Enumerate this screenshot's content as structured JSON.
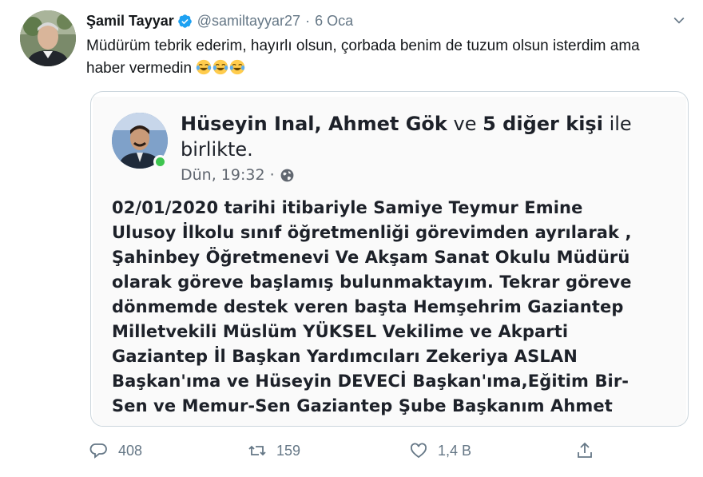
{
  "tweet": {
    "author_name": "Şamil Tayyar",
    "handle": "@samiltayyar27",
    "separator": "·",
    "date": "6 Oca",
    "text": "Müdürüm tebrik ederim, hayırlı olsun, çorbada benim de tuzum olsun isterdim ama haber vermedin",
    "emojis": [
      "face-with-tears-of-joy",
      "face-with-tears-of-joy",
      "face-with-tears-of-joy"
    ],
    "icons": {
      "verified": "verified-badge-icon",
      "menu": "chevron-down-icon"
    },
    "colors": {
      "verified": "#1da1f2",
      "muted": "#657786",
      "border": "#ccd6dd"
    }
  },
  "embed": {
    "header_bold_1": "Hüseyin Inal, Ahmet Gök",
    "header_regular_1": " ve ",
    "header_bold_2": "5 diğer kişi",
    "header_regular_2": " ile birlikte.",
    "meta_time": "Dün, 19:32",
    "meta_separator": "·",
    "body_lines": [
      "02/01/2020 tarihi itibariyle Samiye Teymur Emine",
      "Ulusoy İlkolu sınıf öğretmenliği görevimden ayrılarak ,",
      "Şahinbey Öğretmenevi Ve Akşam Sanat Okulu Müdürü",
      "olarak göreve başlamış bulunmaktayım. Tekrar göreve",
      "dönmemde  destek veren başta Hemşehrim Gaziantep",
      "Milletvekili Müslüm YÜKSEL Vekilime ve Akparti",
      "Gaziantep İl Başkan Yardımcıları Zekeriya ASLAN",
      "Başkan'ıma ve Hüseyin DEVECİ Başkan'ıma,Eğitim Bir-",
      "Sen ve Memur-Sen Gaziantep Şube Başkanım Ahmet"
    ],
    "icons": {
      "privacy": "globe-icon"
    },
    "colors": {
      "online": "#3ec54f"
    }
  },
  "actions": {
    "reply_count": "408",
    "retweet_count": "159",
    "like_count": "1,4 B",
    "icons": [
      "reply-icon",
      "retweet-icon",
      "like-icon",
      "share-icon"
    ]
  }
}
